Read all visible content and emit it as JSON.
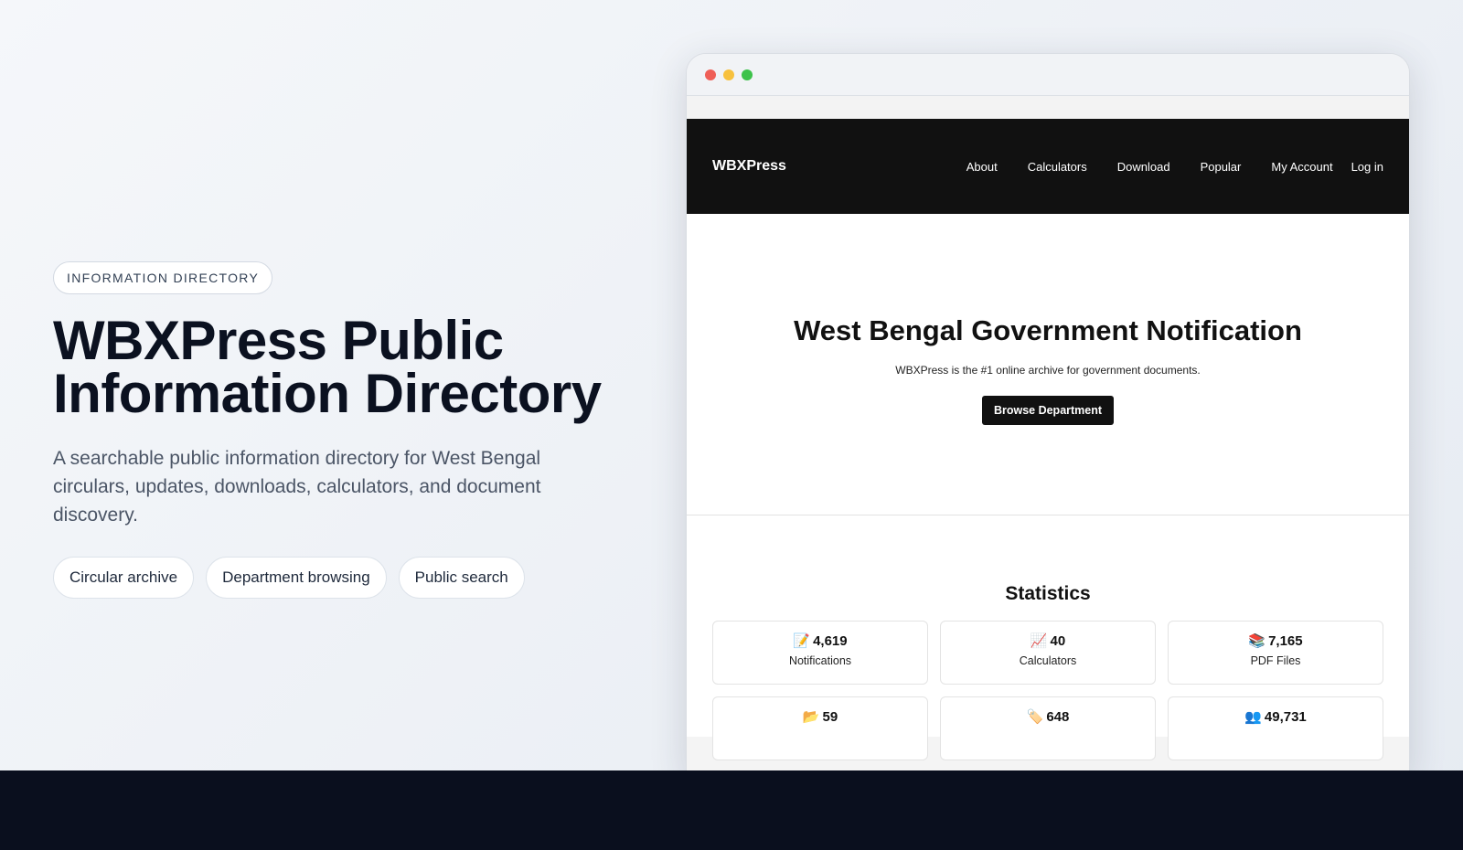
{
  "hero": {
    "eyebrow": "INFORMATION DIRECTORY",
    "title_line1": "WBXPress Public",
    "title_line2": "Information Directory",
    "description": "A searchable public information directory for West Bengal circulars, updates, downloads, calculators, and document discovery.",
    "chips": [
      "Circular archive",
      "Department browsing",
      "Public search"
    ]
  },
  "site": {
    "brand": "WBXPress",
    "nav": [
      "About",
      "Calculators",
      "Download",
      "Popular",
      "My Account",
      "Log in"
    ],
    "title": "West Bengal Government Notification",
    "subtitle": "WBXPress is the #1 online archive for government documents.",
    "cta": "Browse Department"
  },
  "stats": {
    "title": "Statistics",
    "items": [
      {
        "icon": "📝",
        "icon_name": "memo-icon",
        "value": "4,619",
        "label": "Notifications"
      },
      {
        "icon": "📈",
        "icon_name": "chart-increasing-icon",
        "value": "40",
        "label": "Calculators"
      },
      {
        "icon": "📚",
        "icon_name": "books-icon",
        "value": "7,165",
        "label": "PDF Files"
      },
      {
        "icon": "📂",
        "icon_name": "open-folder-icon",
        "value": "59",
        "label": ""
      },
      {
        "icon": "🏷️",
        "icon_name": "label-tag-icon",
        "value": "648",
        "label": ""
      },
      {
        "icon": "👥",
        "icon_name": "users-icon",
        "value": "49,731",
        "label": ""
      }
    ]
  },
  "colors": {
    "nav_bg": "#111111",
    "bottom_band": "#0a0f1e",
    "dot_red": "#ef5f57",
    "dot_yellow": "#f7c13e",
    "dot_green": "#3dc24a"
  }
}
